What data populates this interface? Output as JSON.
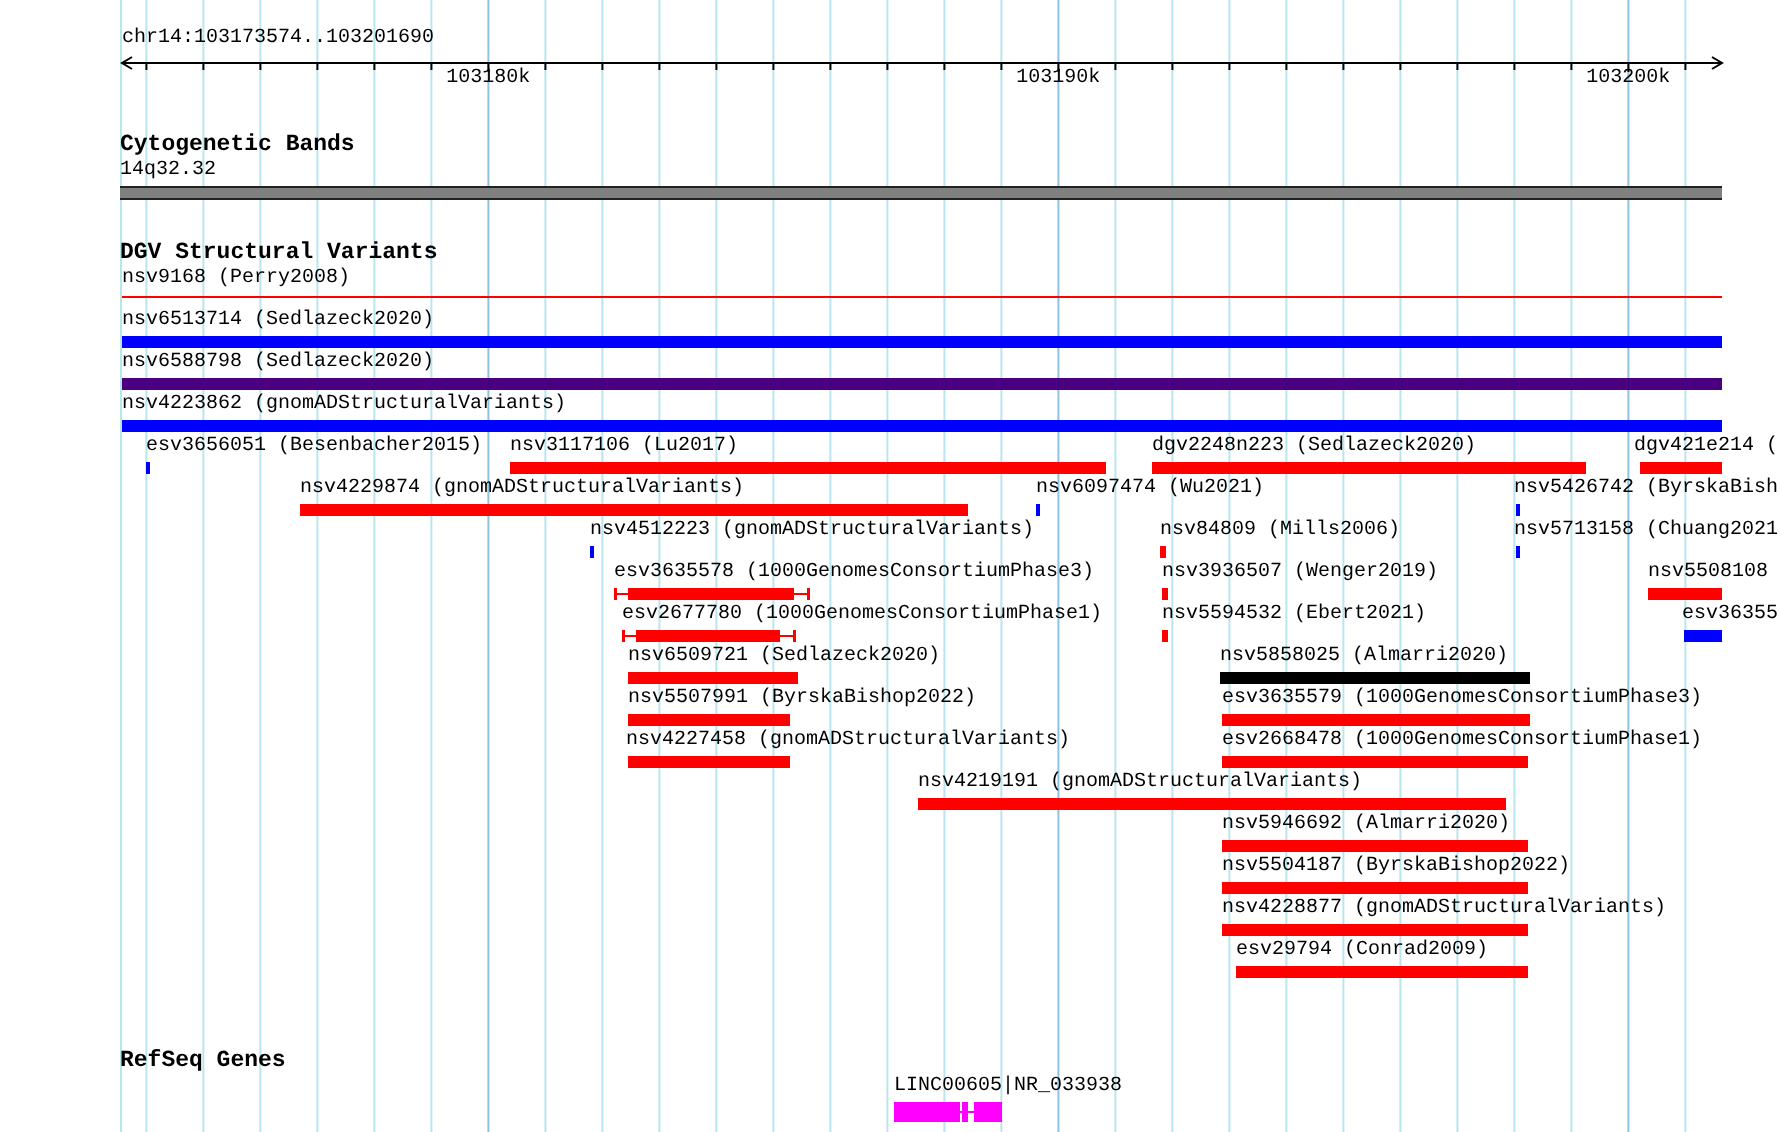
{
  "ruler": {
    "location": "chr14:103173574..103201690",
    "ticks": [
      "103180k",
      "103190k",
      "103200k"
    ]
  },
  "tracks": [
    {
      "title": "Cytogenetic Bands",
      "kind": "bands",
      "features": [
        {
          "label": "14q32.32",
          "kind": "band",
          "color": "#808080"
        }
      ]
    },
    {
      "title": "DGV Structural Variants",
      "kind": "variants",
      "features": [
        {
          "label": "nsv9168 (Perry2008)",
          "kind": "line",
          "color": "#ff0000"
        },
        {
          "label": "nsv6513714 (Sedlazeck2020)",
          "kind": "bar",
          "color": "#0000ff"
        },
        {
          "label": "nsv6588798 (Sedlazeck2020)",
          "kind": "bar",
          "color": "#4b0082"
        },
        {
          "label": "nsv4223862 (gnomADStructuralVariants)",
          "kind": "bar",
          "color": "#0000ff"
        },
        {
          "label": "esv3656051 (Besenbacher2015)",
          "kind": "bar",
          "color": "#0000ff"
        },
        {
          "label": "nsv3117106 (Lu2017)",
          "kind": "bar",
          "color": "#ff0000"
        },
        {
          "label": "dgv2248n223 (Sedlazeck2020)",
          "kind": "bar",
          "color": "#ff0000"
        },
        {
          "label": "dgv421e214 (",
          "kind": "bar",
          "color": "#ff0000"
        },
        {
          "label": "nsv4229874 (gnomADStructuralVariants)",
          "kind": "bar",
          "color": "#ff0000"
        },
        {
          "label": "nsv6097474 (Wu2021)",
          "kind": "bar",
          "color": "#0000ff"
        },
        {
          "label": "nsv5426742 (ByrskaBish",
          "kind": "bar",
          "color": "#0000ff"
        },
        {
          "label": "nsv4512223 (gnomADStructuralVariants)",
          "kind": "bar",
          "color": "#0000ff"
        },
        {
          "label": "nsv84809 (Mills2006)",
          "kind": "bar",
          "color": "#ff0000"
        },
        {
          "label": "nsv5713158 (Chuang2021",
          "kind": "bar",
          "color": "#0000ff"
        },
        {
          "label": "esv3635578 (1000GenomesConsortiumPhase3)",
          "kind": "whisker",
          "color": "#ff0000"
        },
        {
          "label": "nsv3936507 (Wenger2019)",
          "kind": "bar",
          "color": "#ff0000"
        },
        {
          "label": "nsv5508108",
          "kind": "bar",
          "color": "#ff0000"
        },
        {
          "label": "esv2677780 (1000GenomesConsortiumPhase1)",
          "kind": "whisker",
          "color": "#ff0000"
        },
        {
          "label": "nsv5594532 (Ebert2021)",
          "kind": "bar",
          "color": "#ff0000"
        },
        {
          "label": "esv36355",
          "kind": "bar",
          "color": "#0000ff"
        },
        {
          "label": "nsv6509721 (Sedlazeck2020)",
          "kind": "bar",
          "color": "#ff0000"
        },
        {
          "label": "nsv5858025 (Almarri2020)",
          "kind": "bar",
          "color": "#000000"
        },
        {
          "label": "nsv5507991 (ByrskaBishop2022)",
          "kind": "bar",
          "color": "#ff0000"
        },
        {
          "label": "esv3635579 (1000GenomesConsortiumPhase3)",
          "kind": "bar",
          "color": "#ff0000"
        },
        {
          "label": "nsv4227458 (gnomADStructuralVariants)",
          "kind": "bar",
          "color": "#ff0000"
        },
        {
          "label": "esv2668478 (1000GenomesConsortiumPhase1)",
          "kind": "bar",
          "color": "#ff0000"
        },
        {
          "label": "nsv4219191 (gnomADStructuralVariants)",
          "kind": "bar",
          "color": "#ff0000"
        },
        {
          "label": "nsv5946692 (Almarri2020)",
          "kind": "bar",
          "color": "#ff0000"
        },
        {
          "label": "nsv5504187 (ByrskaBishop2022)",
          "kind": "bar",
          "color": "#ff0000"
        },
        {
          "label": "nsv4228877 (gnomADStructuralVariants)",
          "kind": "bar",
          "color": "#ff0000"
        },
        {
          "label": "esv29794 (Conrad2009)",
          "kind": "bar",
          "color": "#ff0000"
        }
      ]
    },
    {
      "title": "RefSeq Genes",
      "kind": "genes",
      "features": [
        {
          "label": "LINC00605|NR_033938",
          "kind": "gene",
          "color": "#ff00ff"
        }
      ]
    }
  ]
}
